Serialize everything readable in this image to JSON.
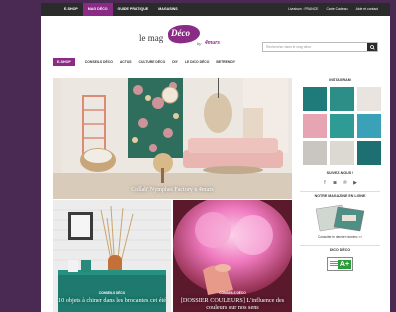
{
  "topbar": {
    "tabs": [
      {
        "label": "E-SHOP",
        "active": false
      },
      {
        "label": "MAG DÉCO",
        "active": true
      },
      {
        "label": "GUIDE PRATIQUE",
        "active": false
      },
      {
        "label": "MAGASINS",
        "active": false
      }
    ],
    "right": [
      "Livraison : FRANCE",
      "Carte Cadeau",
      "Aide et contact"
    ]
  },
  "logo": {
    "le_mag": "le mag",
    "deco": "Déco",
    "by": "by",
    "brand": "4murs"
  },
  "search": {
    "placeholder": "Rechercher dans le mag déco"
  },
  "nav": {
    "eshop": "E-SHOP",
    "items": [
      "CONSEILS DÉCO",
      "ACTUS",
      "CULTURE DÉCO",
      "DIY",
      "LE DICO DÉCO",
      "BETRENDY"
    ]
  },
  "hero": {
    "caption": "Collab' Nymphes Factory x 4murs"
  },
  "cards": [
    {
      "category": "CONSEILS DÉCO",
      "title": "10 objets à chiner dans les brocantes cet été"
    },
    {
      "category": "CONSEILS DÉCO",
      "title": "[DOSSIER COULEURS] L'influence des couleurs sur nos sens"
    }
  ],
  "sidebar": {
    "instagram_title": "INSTAGRAM",
    "follow_title": "SUIVEZ-NOUS !",
    "social_icons": [
      "facebook-icon",
      "instagram-icon",
      "pinterest-icon",
      "youtube-icon"
    ],
    "magazine_title": "NOTRE MAGAZINE EN LIGNE",
    "magazine_link": "Consulter le dernier numéro >>",
    "dico_title": "DICO DÉCO",
    "badge_text": "A+"
  },
  "colors": {
    "brand": "#8a2b86",
    "topbar": "#2b2b2b",
    "outer": "#4a2a52"
  }
}
